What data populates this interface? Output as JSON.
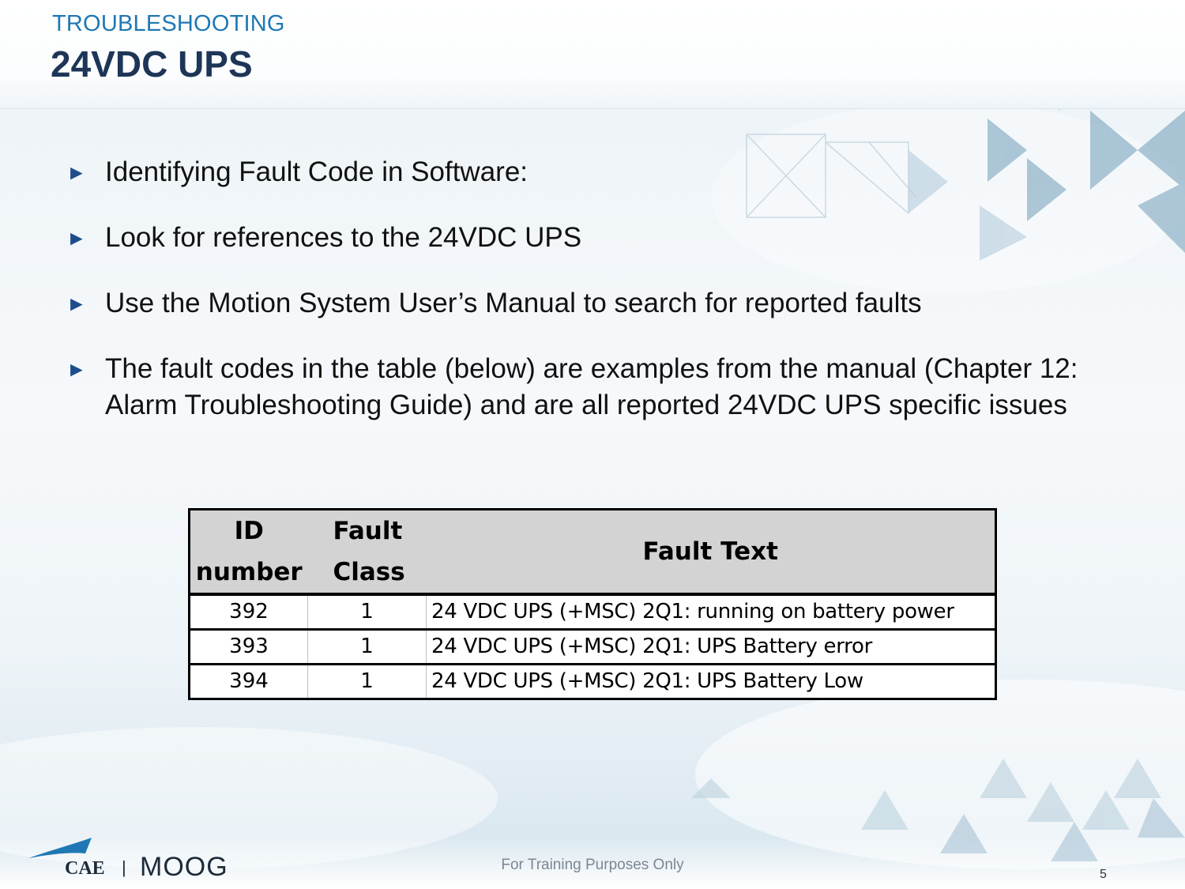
{
  "header": {
    "section_label": "TROUBLESHOOTING",
    "title": "24VDC UPS"
  },
  "bullets": [
    {
      "marker": "►",
      "text": "Identifying Fault Code in Software:"
    },
    {
      "marker": "►",
      "text": "Look for references to the 24VDC UPS"
    },
    {
      "marker": "►",
      "text": "Use the Motion System User’s Manual to search for reported faults"
    },
    {
      "marker": "►",
      "text": "The fault codes in the table (below) are examples from the manual (Chapter 12: Alarm Troubleshooting Guide) and are all reported 24VDC UPS specific issues"
    }
  ],
  "table": {
    "headers": {
      "id_line1": "ID",
      "id_line2": "number",
      "class_line1": "Fault",
      "class_line2": "Class",
      "text": "Fault Text"
    },
    "rows": [
      {
        "id": "392",
        "class": "1",
        "text": "24 VDC UPS (+MSC) 2Q1: running on battery power"
      },
      {
        "id": "393",
        "class": "1",
        "text": "24 VDC UPS (+MSC) 2Q1: UPS Battery error"
      },
      {
        "id": "394",
        "class": "1",
        "text": "24 VDC UPS (+MSC) 2Q1: UPS Battery Low"
      }
    ]
  },
  "footer": {
    "note": "For Training Purposes Only",
    "page_number": "5",
    "logo_left": "CAE",
    "logo_separator": "|",
    "logo_right": "MOOG"
  },
  "colors": {
    "section_label": "#1f78b4",
    "title": "#1d3557",
    "bullet_marker": "#1e4d8c",
    "table_header_bg": "#d3d3d3"
  }
}
